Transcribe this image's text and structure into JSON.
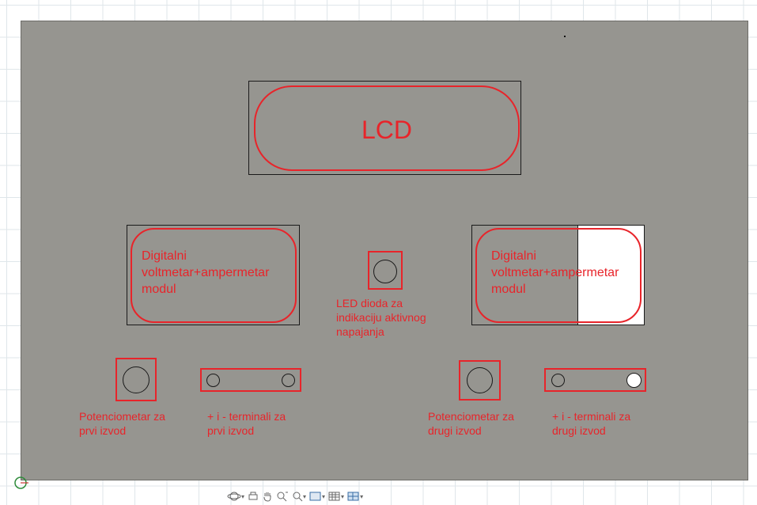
{
  "canvas": {
    "panel_color": "#969590",
    "accent_red": "#e8242a"
  },
  "labels": {
    "lcd": "LCD",
    "module_left": [
      "Digitalni",
      "voltmetar+ampermetar",
      "modul"
    ],
    "module_right": [
      "Digitalni",
      "voltmetar+ampermetar",
      "modul"
    ],
    "led": [
      "LED dioda za",
      "indikaciju aktivnog",
      "napajanja"
    ],
    "pot_left": [
      "Potenciometar za",
      "prvi izvod"
    ],
    "term_left": [
      "+ i - terminali za",
      "prvi izvod"
    ],
    "pot_right": [
      "Potenciometar za",
      "drugi izvod"
    ],
    "term_right": [
      "+ i - terminali za",
      "drugi izvod"
    ]
  },
  "toolbar": {
    "items": [
      {
        "icon": "orbit-icon",
        "dropdown": true
      },
      {
        "icon": "print-icon",
        "dropdown": false
      },
      {
        "icon": "pan-hand-icon",
        "dropdown": false
      },
      {
        "icon": "zoom-window-icon",
        "dropdown": false
      },
      {
        "icon": "zoom-icon",
        "dropdown": true
      },
      {
        "icon": "display-mode-icon",
        "dropdown": true
      },
      {
        "icon": "grid-icon",
        "dropdown": true
      },
      {
        "icon": "viewports-icon",
        "dropdown": true
      }
    ]
  }
}
